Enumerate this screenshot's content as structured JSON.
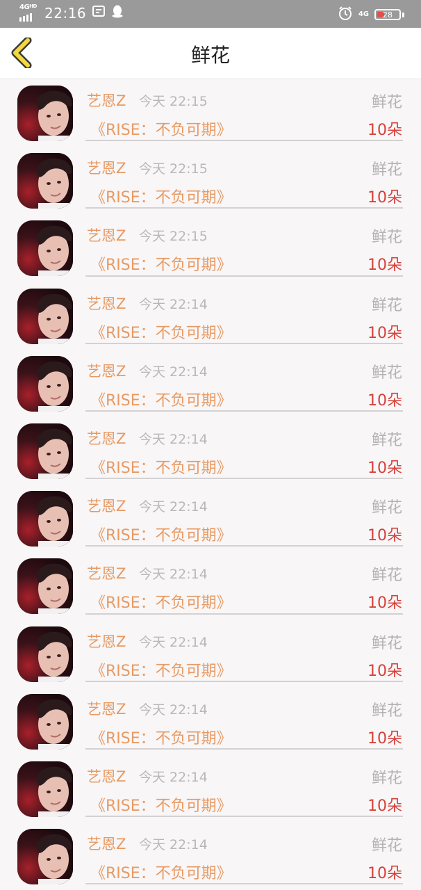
{
  "status_bar": {
    "network_left": "4G",
    "network_left_sub": "HD",
    "time": "22:16",
    "app_icon_1": "notification-app-icon",
    "app_icon_2": "qq-penguin-icon",
    "alarm_icon": "alarm-icon",
    "network_right": "4G",
    "battery_level": "28"
  },
  "header": {
    "back_icon": "chevron-left-icon",
    "title": "鲜花"
  },
  "colors": {
    "name": "#e79a63",
    "work": "#e79a63",
    "time": "#b8b8b8",
    "gift": "#b3b3b3",
    "count": "#d6413b",
    "back_chevron_fill": "#f5d83a"
  },
  "records": [
    {
      "user": "艺恩Z",
      "time": "今天 22:15",
      "gift": "鲜花",
      "work": "《RISE：不负可期》",
      "count": "10朵"
    },
    {
      "user": "艺恩Z",
      "time": "今天 22:15",
      "gift": "鲜花",
      "work": "《RISE：不负可期》",
      "count": "10朵"
    },
    {
      "user": "艺恩Z",
      "time": "今天 22:15",
      "gift": "鲜花",
      "work": "《RISE：不负可期》",
      "count": "10朵"
    },
    {
      "user": "艺恩Z",
      "time": "今天 22:14",
      "gift": "鲜花",
      "work": "《RISE：不负可期》",
      "count": "10朵"
    },
    {
      "user": "艺恩Z",
      "time": "今天 22:14",
      "gift": "鲜花",
      "work": "《RISE：不负可期》",
      "count": "10朵"
    },
    {
      "user": "艺恩Z",
      "time": "今天 22:14",
      "gift": "鲜花",
      "work": "《RISE：不负可期》",
      "count": "10朵"
    },
    {
      "user": "艺恩Z",
      "time": "今天 22:14",
      "gift": "鲜花",
      "work": "《RISE：不负可期》",
      "count": "10朵"
    },
    {
      "user": "艺恩Z",
      "time": "今天 22:14",
      "gift": "鲜花",
      "work": "《RISE：不负可期》",
      "count": "10朵"
    },
    {
      "user": "艺恩Z",
      "time": "今天 22:14",
      "gift": "鲜花",
      "work": "《RISE：不负可期》",
      "count": "10朵"
    },
    {
      "user": "艺恩Z",
      "time": "今天 22:14",
      "gift": "鲜花",
      "work": "《RISE：不负可期》",
      "count": "10朵"
    },
    {
      "user": "艺恩Z",
      "time": "今天 22:14",
      "gift": "鲜花",
      "work": "《RISE：不负可期》",
      "count": "10朵"
    },
    {
      "user": "艺恩Z",
      "time": "今天 22:14",
      "gift": "鲜花",
      "work": "《RISE：不负可期》",
      "count": "10朵"
    }
  ]
}
